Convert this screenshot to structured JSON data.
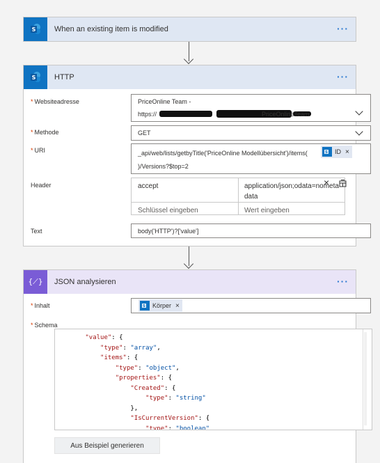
{
  "trigger": {
    "title": "When an existing item is modified",
    "more": "···"
  },
  "http": {
    "title": "HTTP",
    "more": "···",
    "site_label": "Websiteadresse",
    "site_line1": "PriceOnline Team -",
    "site_line2_prefix": "https://",
    "site_line2_suffix": "PriceOnlineTeam",
    "method_label": "Methode",
    "method_value": "GET",
    "uri_label": "URI",
    "uri_line1": "_api/web/lists/getbyTitle('PriceOnline Modellübersicht')/items(",
    "uri_token": "ID",
    "uri_line2": ")/Versions?$top=2",
    "header_label": "Header",
    "header_key": "accept",
    "header_value_line1": "application/json;odata=nometa",
    "header_value_line2": "data",
    "key_placeholder": "Schlüssel eingeben",
    "value_placeholder": "Wert eingeben",
    "text_label": "Text",
    "text_value": "body('HTTP')?['value']"
  },
  "json": {
    "title": "JSON analysieren",
    "more": "···",
    "content_label": "Inhalt",
    "content_token": "Körper",
    "schema_label": "Schema",
    "schema_lines": [
      {
        "indent": "        ",
        "key": "\"value\"",
        "rest": ": {"
      },
      {
        "indent": "            ",
        "key": "\"type\"",
        "rest": ": ",
        "val": "\"array\"",
        "tail": ","
      },
      {
        "indent": "            ",
        "key": "\"items\"",
        "rest": ": {"
      },
      {
        "indent": "                ",
        "key": "\"type\"",
        "rest": ": ",
        "val": "\"object\"",
        "tail": ","
      },
      {
        "indent": "                ",
        "key": "\"properties\"",
        "rest": ": {"
      },
      {
        "indent": "                    ",
        "key": "\"Created\"",
        "rest": ": {"
      },
      {
        "indent": "                        ",
        "key": "\"type\"",
        "rest": ": ",
        "val": "\"string\""
      },
      {
        "indent": "                    ",
        "key": "",
        "rest": "},"
      },
      {
        "indent": "                    ",
        "key": "\"IsCurrentVersion\"",
        "rest": ": {"
      },
      {
        "indent": "                        ",
        "key": "\"type\"",
        "rest": ": ",
        "val": "\"boolean\""
      }
    ],
    "generate_button": "Aus Beispiel generieren"
  },
  "colors": {
    "sharepoint": "#0f73c2",
    "json_action": "#7a5cd6",
    "link": "#2b79d0",
    "required": "#d83b01"
  },
  "icons": {
    "sharepoint": "sharepoint-icon",
    "json": "braces-icon",
    "more": "more-icon",
    "chevron": "chevron-down-icon",
    "delete": "close-icon",
    "switch_mode": "switch-mode-icon"
  }
}
